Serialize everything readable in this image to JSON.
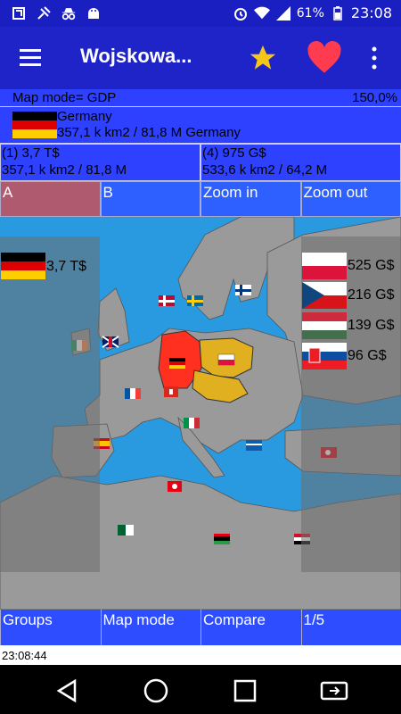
{
  "statusbar": {
    "battery": "61%",
    "time": "23:08"
  },
  "toolbar": {
    "title": "Wojskowa..."
  },
  "info": {
    "mode": "Map mode= GDP",
    "zoom": "150,0%",
    "country": {
      "name": "Germany",
      "details": "357,1 k km2 / 81,8 M Germany"
    },
    "col_a": {
      "line1": "(1) 3,7 T$",
      "line2": "357,1 k km2 / 81,8 M"
    },
    "col_b": {
      "line1": "(4) 975 G$",
      "line2": "533,6 k km2 / 64,2 M"
    }
  },
  "actions": {
    "a": "A",
    "b": "B",
    "zoom_in": "Zoom in",
    "zoom_out": "Zoom out"
  },
  "left_panel": {
    "value": "3,7 T$"
  },
  "right_panel": [
    {
      "value": "525 G$"
    },
    {
      "value": "216 G$"
    },
    {
      "value": "139 G$"
    },
    {
      "value": "96 G$"
    }
  ],
  "bottom": {
    "groups": "Groups",
    "map_mode": "Map mode",
    "compare": "Compare",
    "page": "1/5"
  },
  "clock": "23:08:44",
  "colors": {
    "germany": "#ff3020",
    "group": "#e0b020",
    "water": "#2a9ae0",
    "land": "#9a9a9a",
    "bar": "#1f24c9"
  }
}
